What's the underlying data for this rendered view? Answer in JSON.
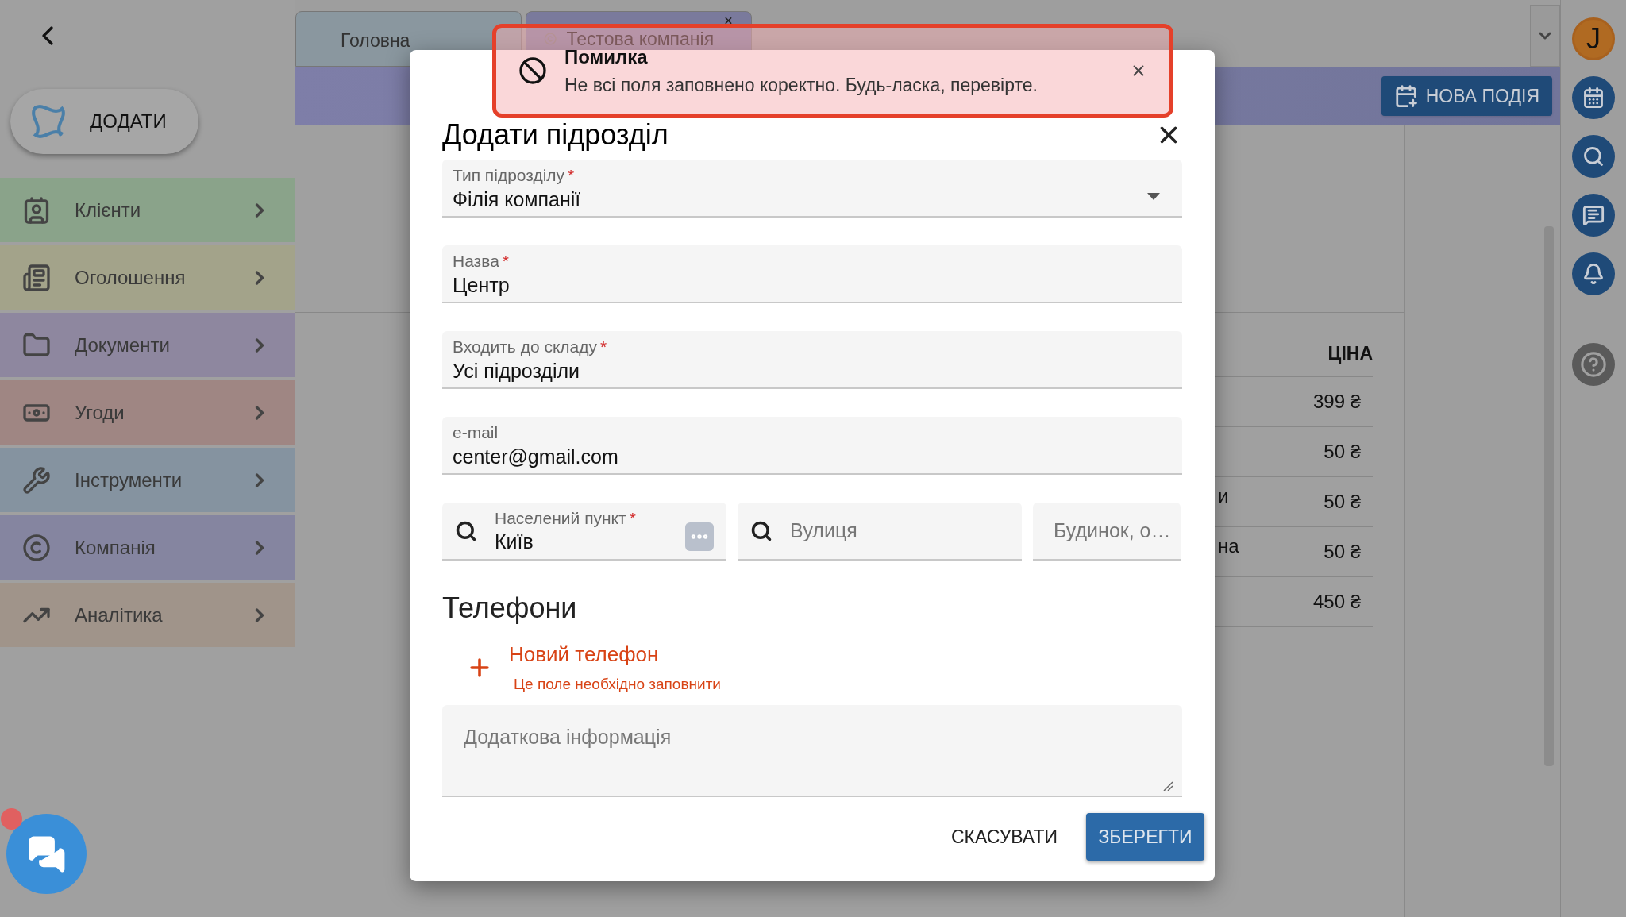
{
  "sidebar": {
    "add_button": "ДОДАТИ",
    "items": [
      {
        "kind": "clients",
        "label": "Клієнти",
        "color": "#8aa38a"
      },
      {
        "kind": "ads",
        "label": "Оголошення",
        "color": "#a3a38a"
      },
      {
        "kind": "documents",
        "label": "Документи",
        "color": "#8e879f"
      },
      {
        "kind": "deals",
        "label": "Угоди",
        "color": "#9f8683"
      },
      {
        "kind": "tools",
        "label": "Інструменти",
        "color": "#8593a0"
      },
      {
        "kind": "company",
        "label": "Компанія",
        "color": "#8585a0"
      },
      {
        "kind": "analytics",
        "label": "Аналітика",
        "color": "#a0948a"
      }
    ]
  },
  "tabs": [
    {
      "label": "Головна",
      "selected": false
    },
    {
      "label": "Тестова компанія",
      "selected": true
    }
  ],
  "header": {
    "new_event_button": "НОВА ПОДІЯ"
  },
  "table": {
    "columns": [
      "ЦІНА"
    ],
    "rows": [
      {
        "price": "399 ₴"
      },
      {
        "price": "50 ₴"
      },
      {
        "fragment": "и",
        "price": "50 ₴"
      },
      {
        "fragment": "на",
        "price": "50 ₴"
      },
      {
        "price": "450 ₴"
      }
    ]
  },
  "user_avatar": "J",
  "dialog": {
    "title": "Додати підрозділ",
    "fields": [
      {
        "kind": "select",
        "label": "Тип підрозділу",
        "required_mark": "*",
        "value": "Філія компанії"
      },
      {
        "kind": "text",
        "label": "Назва",
        "required_mark": "*",
        "value": "Центр"
      },
      {
        "kind": "text",
        "label": "Входить до складу",
        "required_mark": "*",
        "value": "Усі підрозділи"
      },
      {
        "kind": "text",
        "label": "e-mail",
        "value": "center@gmail.com"
      }
    ],
    "address": [
      {
        "kind": "search",
        "label": "Населений пункт",
        "required_mark": "*",
        "value": "Київ"
      },
      {
        "kind": "search",
        "placeholder": "Вулиця"
      },
      {
        "kind": "plain",
        "placeholder": "Будинок, о…"
      }
    ],
    "phones_heading": "Телефони",
    "add_phone": "Новий телефон",
    "phone_error": "Це поле необхідно заповнити",
    "notes_placeholder": "Додаткова інформація",
    "cancel_button": "СКАСУВАТИ",
    "save_button": "ЗБЕРЕГТИ"
  },
  "toast": {
    "title": "Помилка",
    "message": "Не всі поля заповнено коректно. Будь-ласка, перевірте."
  }
}
